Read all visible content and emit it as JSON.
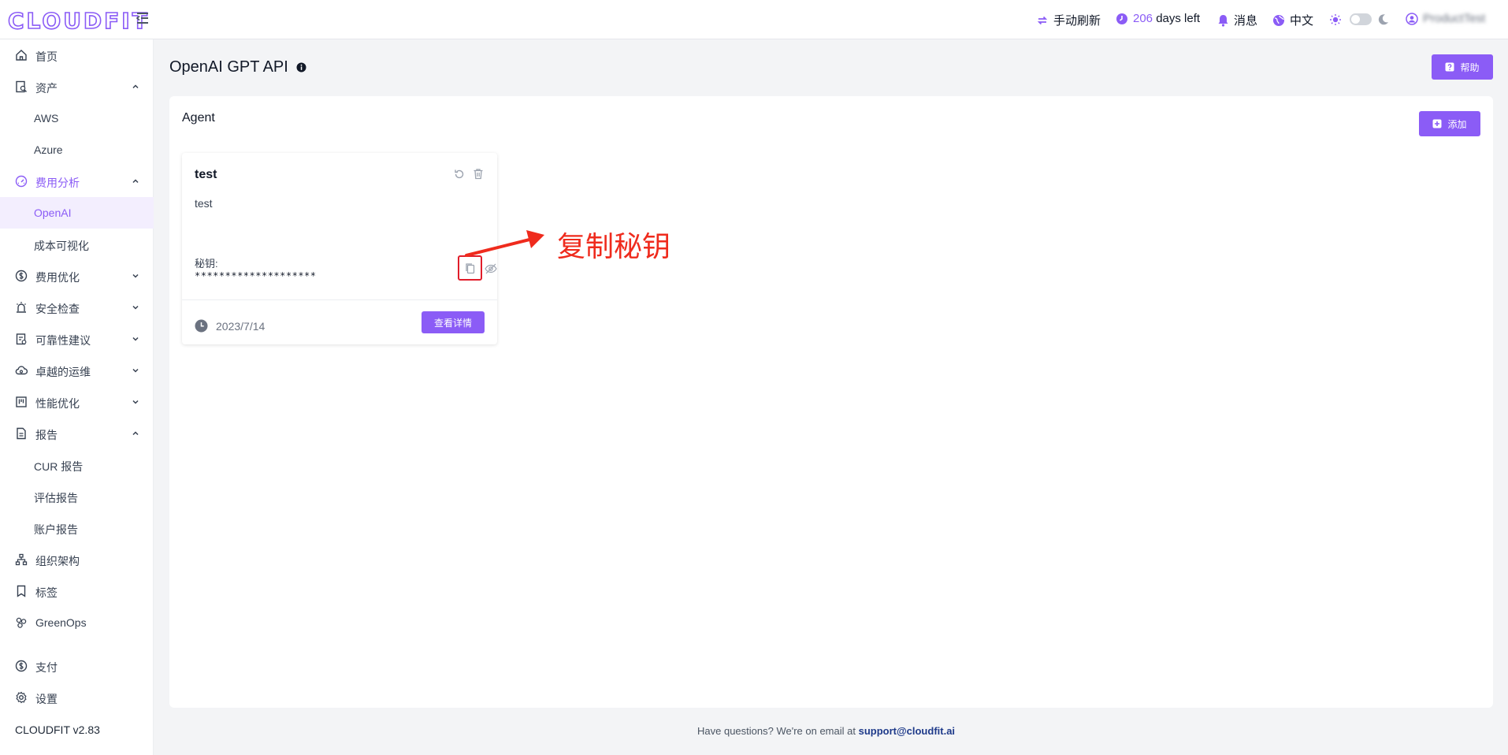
{
  "header": {
    "logo": "CLOUDFIT",
    "refresh_label": "手动刷新",
    "days_value": "206",
    "days_suffix": "days left",
    "messages_label": "消息",
    "language_label": "中文",
    "user_name": "ProductTest"
  },
  "sidebar": {
    "items": [
      {
        "label": "首页",
        "icon": "home-icon"
      },
      {
        "label": "资产",
        "icon": "asset-search-icon"
      },
      {
        "label": "AWS"
      },
      {
        "label": "Azure"
      },
      {
        "label": "费用分析",
        "icon": "gauge-icon"
      },
      {
        "label": "OpenAI"
      },
      {
        "label": "成本可视化"
      },
      {
        "label": "费用优化",
        "icon": "dollar-icon"
      },
      {
        "label": "安全检查",
        "icon": "alarm-icon"
      },
      {
        "label": "可靠性建议",
        "icon": "clipboard-icon"
      },
      {
        "label": "卓越的运维",
        "icon": "cloud-ops-icon"
      },
      {
        "label": "性能优化",
        "icon": "kanban-icon"
      },
      {
        "label": "报告",
        "icon": "document-icon"
      },
      {
        "label": "CUR 报告"
      },
      {
        "label": "评估报告"
      },
      {
        "label": "账户报告"
      },
      {
        "label": "组织架构",
        "icon": "org-chart-icon"
      },
      {
        "label": "标签",
        "icon": "bookmark-icon"
      },
      {
        "label": "GreenOps",
        "icon": "leaf-icon"
      },
      {
        "label": "支付",
        "icon": "payment-icon"
      },
      {
        "label": "设置",
        "icon": "settings-icon"
      }
    ],
    "version": "CLOUDFIT v2.83"
  },
  "page": {
    "title": "OpenAI GPT API",
    "help_label": "帮助"
  },
  "panel": {
    "title": "Agent",
    "add_label": "添加"
  },
  "card": {
    "title": "test",
    "description": "test",
    "key_label": "秘钥:",
    "key_value": "********************",
    "date": "2023/7/14",
    "details_label": "查看详情"
  },
  "annotation": {
    "text": "复制秘钥",
    "color": "#ef2b1d"
  },
  "footer": {
    "text": "Have questions? We're on email at",
    "email": "support@cloudfit.ai"
  },
  "colors": {
    "accent": "#8b5cf6",
    "active_bg": "#f3eefe"
  }
}
